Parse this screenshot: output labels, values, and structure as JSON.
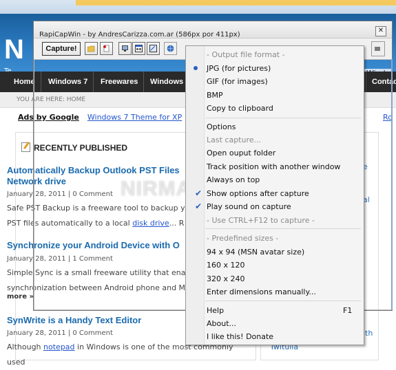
{
  "background": {
    "site_logo": "N",
    "site_tagline": "Te",
    "header_right": "Windo",
    "nav": [
      "Home",
      "Windows 7",
      "Freewares",
      "Windows V",
      "Contac"
    ],
    "breadcrumb": "YOU ARE HERE:   HOME",
    "ads_label": "Ads by Google",
    "ads_link": "Windows 7 Theme for XP",
    "ads_right": "Ro",
    "section_title": "RECENTLY PUBLISHED",
    "posts": [
      {
        "title_l1": "Automatically Backup Outlook PST Files",
        "title_l2": "Network drive",
        "meta": "January 28, 2011   |   0 Comment",
        "text_l1": "Safe PST Backup is a freeware tool to backup y",
        "text_l2a": "PST files automatically to a local ",
        "text_l2_link": "disk drive",
        "text_l2b": "... R"
      },
      {
        "title_l1": "Synchronize your Android Device with O",
        "meta": "January 28, 2011   |   1 Comment",
        "text_l1": "Simple Sync is a small freeware utility that ena",
        "text_l2": "synchronization between Android phone and M",
        "more": "more »"
      },
      {
        "title_l1": "SynWrite is a Handy Text Editor",
        "meta": "January 28, 2011   |   0 Comment",
        "text_a": "Although ",
        "text_link": "notepad",
        "text_b": " in Windows is one of the most commonly used"
      }
    ],
    "sidebar_links": [
      "e",
      "al",
      "ith",
      "Twitulla"
    ],
    "watermark": "NIRMALTV.COM"
  },
  "window": {
    "title": "RapiCapWin - by AndresCarizza.com.ar (586px por 411px)",
    "close_label": "✕",
    "capture_label": "Capture!"
  },
  "menu": {
    "items": [
      {
        "label": "- Output file format -",
        "disabled": true
      },
      {
        "label": "JPG (for pictures)",
        "radio": true
      },
      {
        "label": "GIF (for images)"
      },
      {
        "label": "BMP"
      },
      {
        "label": "Copy to clipboard"
      },
      {
        "label": "Options"
      },
      {
        "label": "Last capture...",
        "disabled": true
      },
      {
        "label": "Open ouput folder"
      },
      {
        "label": "Track position with another window"
      },
      {
        "label": "Always on top"
      },
      {
        "label": "Show options after capture",
        "checked": true
      },
      {
        "label": "Play sound on capture",
        "checked": true
      },
      {
        "label": "- Use CTRL+F12 to capture -",
        "disabled": true
      },
      {
        "label": "- Predefined sizes -",
        "disabled": true
      },
      {
        "label": "94 x 94 (MSN avatar size)"
      },
      {
        "label": "160 x 120"
      },
      {
        "label": "320 x 240"
      },
      {
        "label": "Enter dimensions manually..."
      },
      {
        "label": "Help",
        "accel": "F1"
      },
      {
        "label": "About..."
      },
      {
        "label": "I like this! Donate"
      }
    ]
  }
}
